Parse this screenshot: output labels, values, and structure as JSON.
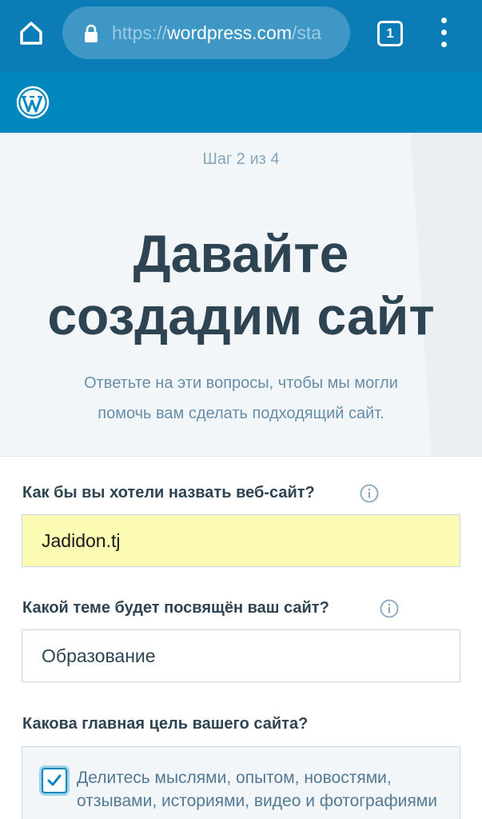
{
  "browser": {
    "url_protocol": "https://",
    "url_host": "wordpress.com",
    "url_path": "/sta",
    "tab_count": "1",
    "icons": {
      "home": "home-icon",
      "lock": "lock-icon",
      "menu": "more-vertical-icon"
    }
  },
  "header": {
    "logo": "wordpress-logo-icon"
  },
  "hero": {
    "step": "Шаг 2 из 4",
    "title_line1": "Давайте",
    "title_line2": "создадим сайт",
    "subtitle_line1": "Ответьте на эти вопросы, чтобы мы могли",
    "subtitle_line2": "помочь вам сделать подходящий сайт."
  },
  "form": {
    "site_name_label": "Как бы вы хотели назвать веб-сайт?",
    "site_name_value": "Jadidon.tj",
    "topic_label": "Какой теме будет посвящён ваш сайт?",
    "topic_value": "Образование",
    "goal_label": "Какова главная цель вашего сайта?",
    "goal_option_text": "Делитесь мыслями, опытом, новостями, отзывами, историями, видео и фотографиями",
    "goal_option_checked": true
  },
  "colors": {
    "browser_bar": "#0c7cb6",
    "wp_blue": "#0087be",
    "title_text": "#2e4453",
    "autofill_bg": "#fbfbb3"
  }
}
